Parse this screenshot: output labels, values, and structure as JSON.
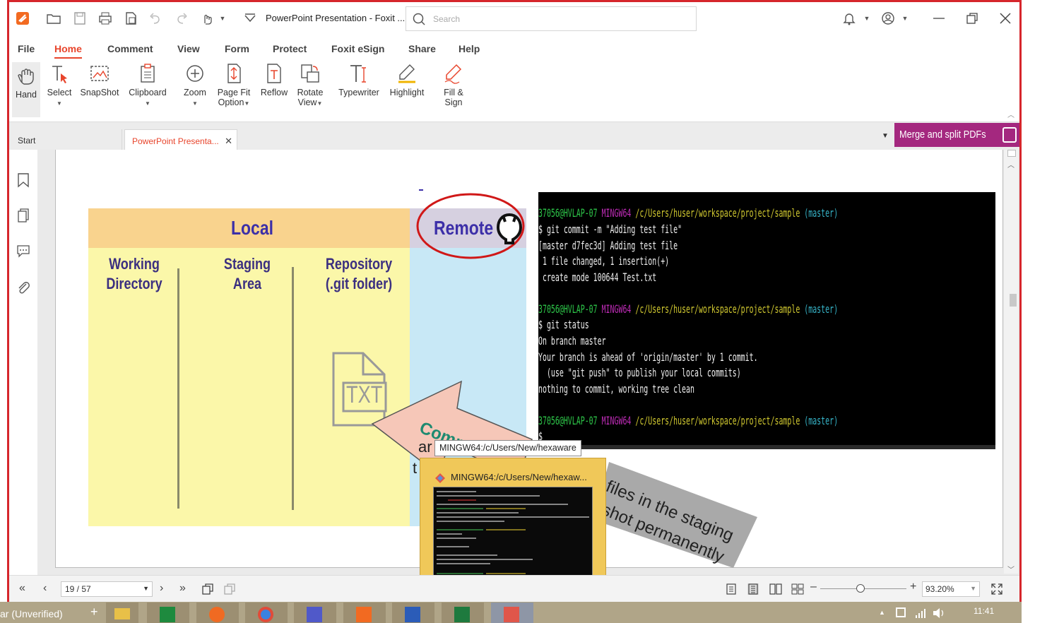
{
  "titlebar": {
    "doc_title": "PowerPoint Presentation - Foxit ...",
    "search_placeholder": "Search",
    "icons": [
      "open-folder-icon",
      "save-icon",
      "print-icon",
      "create-icon",
      "undo-icon",
      "redo-icon",
      "touch-icon",
      "customize-icon",
      "bell-icon",
      "account-icon",
      "minimize-icon",
      "restore-icon",
      "close-icon"
    ]
  },
  "menu": {
    "items": [
      "File",
      "Home",
      "Comment",
      "View",
      "Form",
      "Protect",
      "Foxit eSign",
      "Share",
      "Help"
    ],
    "active": "Home"
  },
  "ribbon": {
    "hand": "Hand",
    "select": "Select",
    "snapshot": "SnapShot",
    "clipboard": "Clipboard",
    "zoom": "Zoom",
    "pagefit_1": "Page Fit",
    "pagefit_2": "Option",
    "reflow": "Reflow",
    "rotate_1": "Rotate",
    "rotate_2": "View",
    "typewriter": "Typewriter",
    "highlight": "Highlight",
    "fillsign_1": "Fill &",
    "fillsign_2": "Sign"
  },
  "tabs": {
    "start": "Start",
    "doc": "PowerPoint Presenta...",
    "merge": "Merge and split PDFs"
  },
  "slide": {
    "local": "Local",
    "remote": "Remote",
    "col1_a": "Working",
    "col1_b": "Directory",
    "col2_a": "Staging",
    "col2_b": "Area",
    "col3_a": "Repository",
    "col3_b": "(.git folder)",
    "file_label": "TXT",
    "arrow_commit": "Commi",
    "arrow_frag1": "ar",
    "arrow_frag2": "t",
    "banner_1": "files in the staging",
    "banner_2": "shot permanently"
  },
  "terminal": {
    "user": "37056@HVLAP-07",
    "env": "MINGW64",
    "path": "/c/Users/huser/workspace/project/sample",
    "branch": "(master)",
    "cmd1": "$ git commit -m \"Adding test file\"",
    "out1": "[master d7fec3d] Adding test file",
    "out2": " 1 file changed, 1 insertion(+)",
    "out3": " create mode 100644 Test.txt",
    "cmd2": "$ git status",
    "out4": "On branch master",
    "out5": "Your branch is ahead of 'origin/master' by 1 commit.",
    "out6": "  (use \"git push\" to publish your local commits)",
    "out7": "nothing to commit, working tree clean",
    "prompt": "$"
  },
  "tooltip": "MINGW64:/c/Users/New/hexaware",
  "thumbnail_title": "MINGW64:/c/Users/New/hexaw...",
  "bottombar": {
    "page": "19 / 57",
    "zoom": "93.20%"
  },
  "taskbar": {
    "left_text": "ar (Unverified)",
    "time": "11:41",
    "apps": [
      "file-explorer-icon",
      "excel-green-icon",
      "firefox-icon",
      "chrome-icon",
      "teams-icon",
      "foxit-icon",
      "word-icon",
      "excel-icon",
      "photos-icon"
    ]
  },
  "colors": {
    "accent": "#e8452c",
    "frame": "#d6262c",
    "merge_bg": "#a4287f",
    "slide_local_band": "#f9d38e",
    "slide_local_body": "#fbf7a9",
    "slide_remote_body": "#c8e8f6"
  }
}
